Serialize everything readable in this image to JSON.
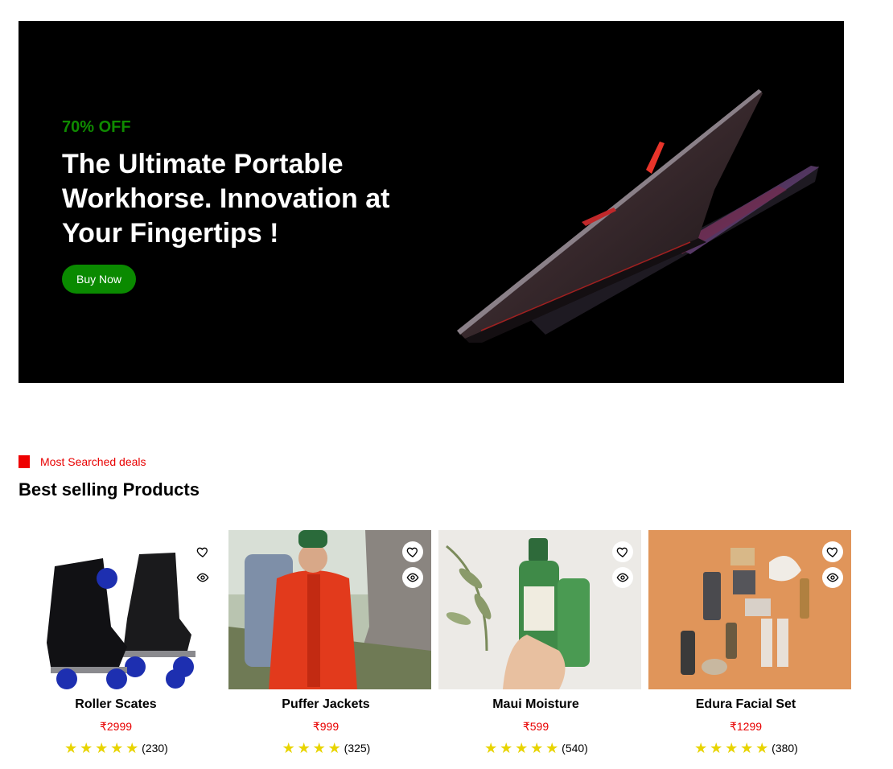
{
  "hero": {
    "discount": "70% OFF",
    "title": "The Ultimate Portable Workhorse. Innovation at Your Fingertips !",
    "button_label": "Buy Now",
    "image_icon": "laptop-image"
  },
  "section": {
    "tag": "Most Searched deals",
    "title": "Best selling Products"
  },
  "products": [
    {
      "name": "Roller Scates",
      "price": "₹2999",
      "stars": 5,
      "reviews": "(230)"
    },
    {
      "name": "Puffer Jackets",
      "price": "₹999",
      "stars": 4,
      "reviews": "(325)"
    },
    {
      "name": "Maui Moisture",
      "price": "₹599",
      "stars": 5,
      "reviews": "(540)"
    },
    {
      "name": "Edura Facial Set",
      "price": "₹1299",
      "stars": 5,
      "reviews": "(380)"
    }
  ],
  "icons": {
    "favorite": "heart-icon",
    "quick_view": "eye-icon",
    "rating": "star-icon"
  },
  "colors": {
    "accent_green": "#0a8a00",
    "accent_red": "#e80000",
    "star_yellow": "#e8d400"
  }
}
